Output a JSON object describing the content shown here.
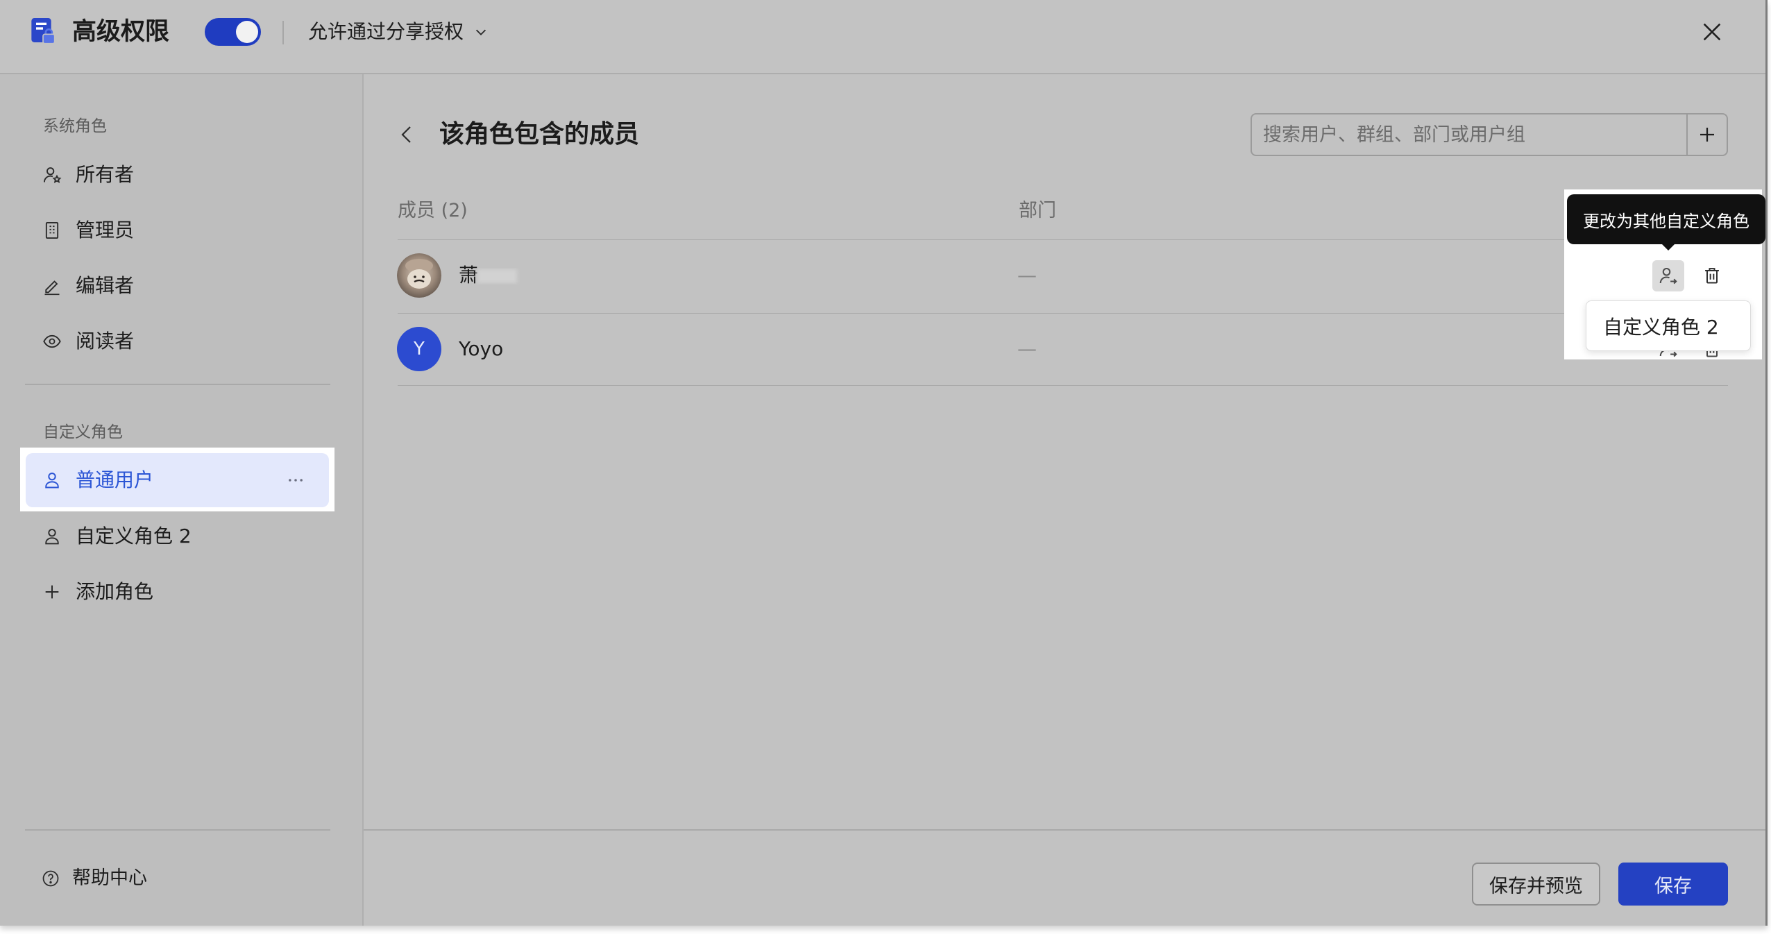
{
  "header": {
    "title": "高级权限",
    "logo_icon": "doc-lock-icon",
    "toggle_on": true,
    "share_option": "允许通过分享授权"
  },
  "sidebar": {
    "system_section_label": "系统角色",
    "system_roles": [
      {
        "label": "所有者",
        "icon": "owner-icon"
      },
      {
        "label": "管理员",
        "icon": "building-icon"
      },
      {
        "label": "编辑者",
        "icon": "pencil-icon"
      },
      {
        "label": "阅读者",
        "icon": "eye-icon"
      }
    ],
    "custom_section_label": "自定义角色",
    "custom_roles": [
      {
        "label": "普通用户",
        "icon": "user-icon",
        "selected": true
      },
      {
        "label": "自定义角色 2",
        "icon": "user-icon",
        "selected": false
      }
    ],
    "add_role_label": "添加角色",
    "help_label": "帮助中心"
  },
  "main": {
    "title": "该角色包含的成员",
    "search_placeholder": "搜索用户、群组、部门或用户组",
    "column_member": "成员 (2)",
    "column_department": "部门",
    "members": [
      {
        "name": "萧",
        "avatar_icon": "user-photo-icon",
        "department": "—"
      },
      {
        "name": "Yoyo",
        "initial": "Y",
        "department": "—"
      }
    ],
    "tooltip": "更改为其他自定义角色",
    "role_menu": [
      "自定义角色 2"
    ]
  },
  "footer": {
    "save_preview_label": "保存并预览",
    "save_label": "保存"
  },
  "colors": {
    "accent": "#1f3cc0",
    "selected_bg": "#e3e8fc",
    "selected_text": "#2b55d5",
    "tooltip_bg": "#111111",
    "avatar_blue": "#2c4bd0"
  }
}
